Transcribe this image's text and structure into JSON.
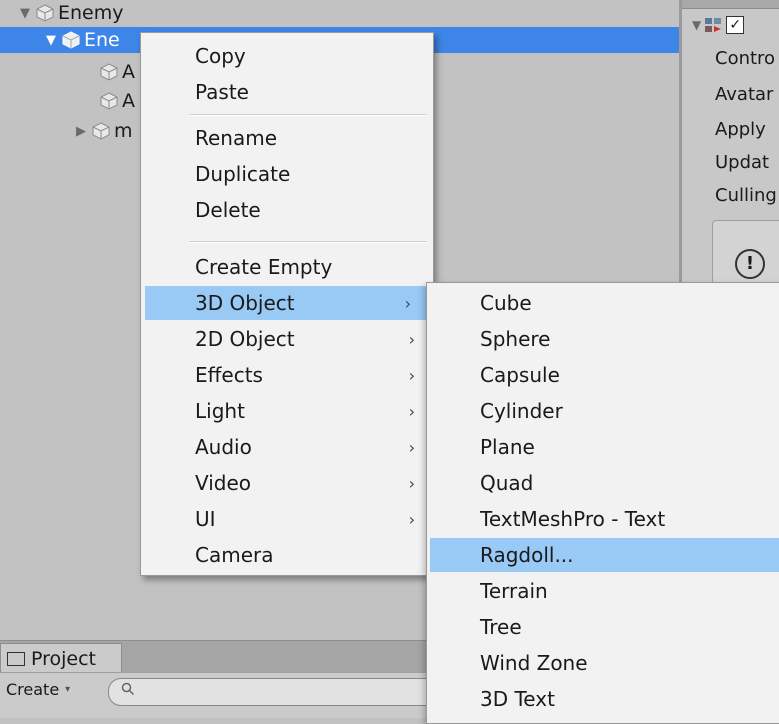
{
  "hierarchy": {
    "rows": [
      {
        "label": "Enemy",
        "fold": "▼"
      },
      {
        "label": "Ene",
        "fold": "▼"
      },
      {
        "label": "A"
      },
      {
        "label": "A"
      },
      {
        "label": "m",
        "fold": "▶"
      }
    ]
  },
  "inspector": {
    "labels": [
      "Contro",
      "Avatar",
      "Apply",
      "Updat",
      "Culling"
    ],
    "warning_glyph": "!"
  },
  "project": {
    "tab_label": "Project",
    "create_label": "Create",
    "create_arrow": "▾",
    "search_glyph": "🔍"
  },
  "context_menu": {
    "items": [
      "Copy",
      "Paste",
      "Rename",
      "Duplicate",
      "Delete",
      "Create Empty",
      "3D Object",
      "2D Object",
      "Effects",
      "Light",
      "Audio",
      "Video",
      "UI",
      "Camera"
    ],
    "submenu_glyph": "›",
    "highlighted": "3D Object"
  },
  "submenu_3d": {
    "items": [
      "Cube",
      "Sphere",
      "Capsule",
      "Cylinder",
      "Plane",
      "Quad",
      "TextMeshPro - Text",
      "Ragdoll...",
      "Terrain",
      "Tree",
      "Wind Zone",
      "3D Text"
    ],
    "highlighted": "Ragdoll..."
  },
  "colors": {
    "selection": "#3d85e6",
    "menu_highlight": "#99c9f5",
    "menu_bg": "#f2f2f2",
    "panel_bg": "#c2c2c2"
  }
}
